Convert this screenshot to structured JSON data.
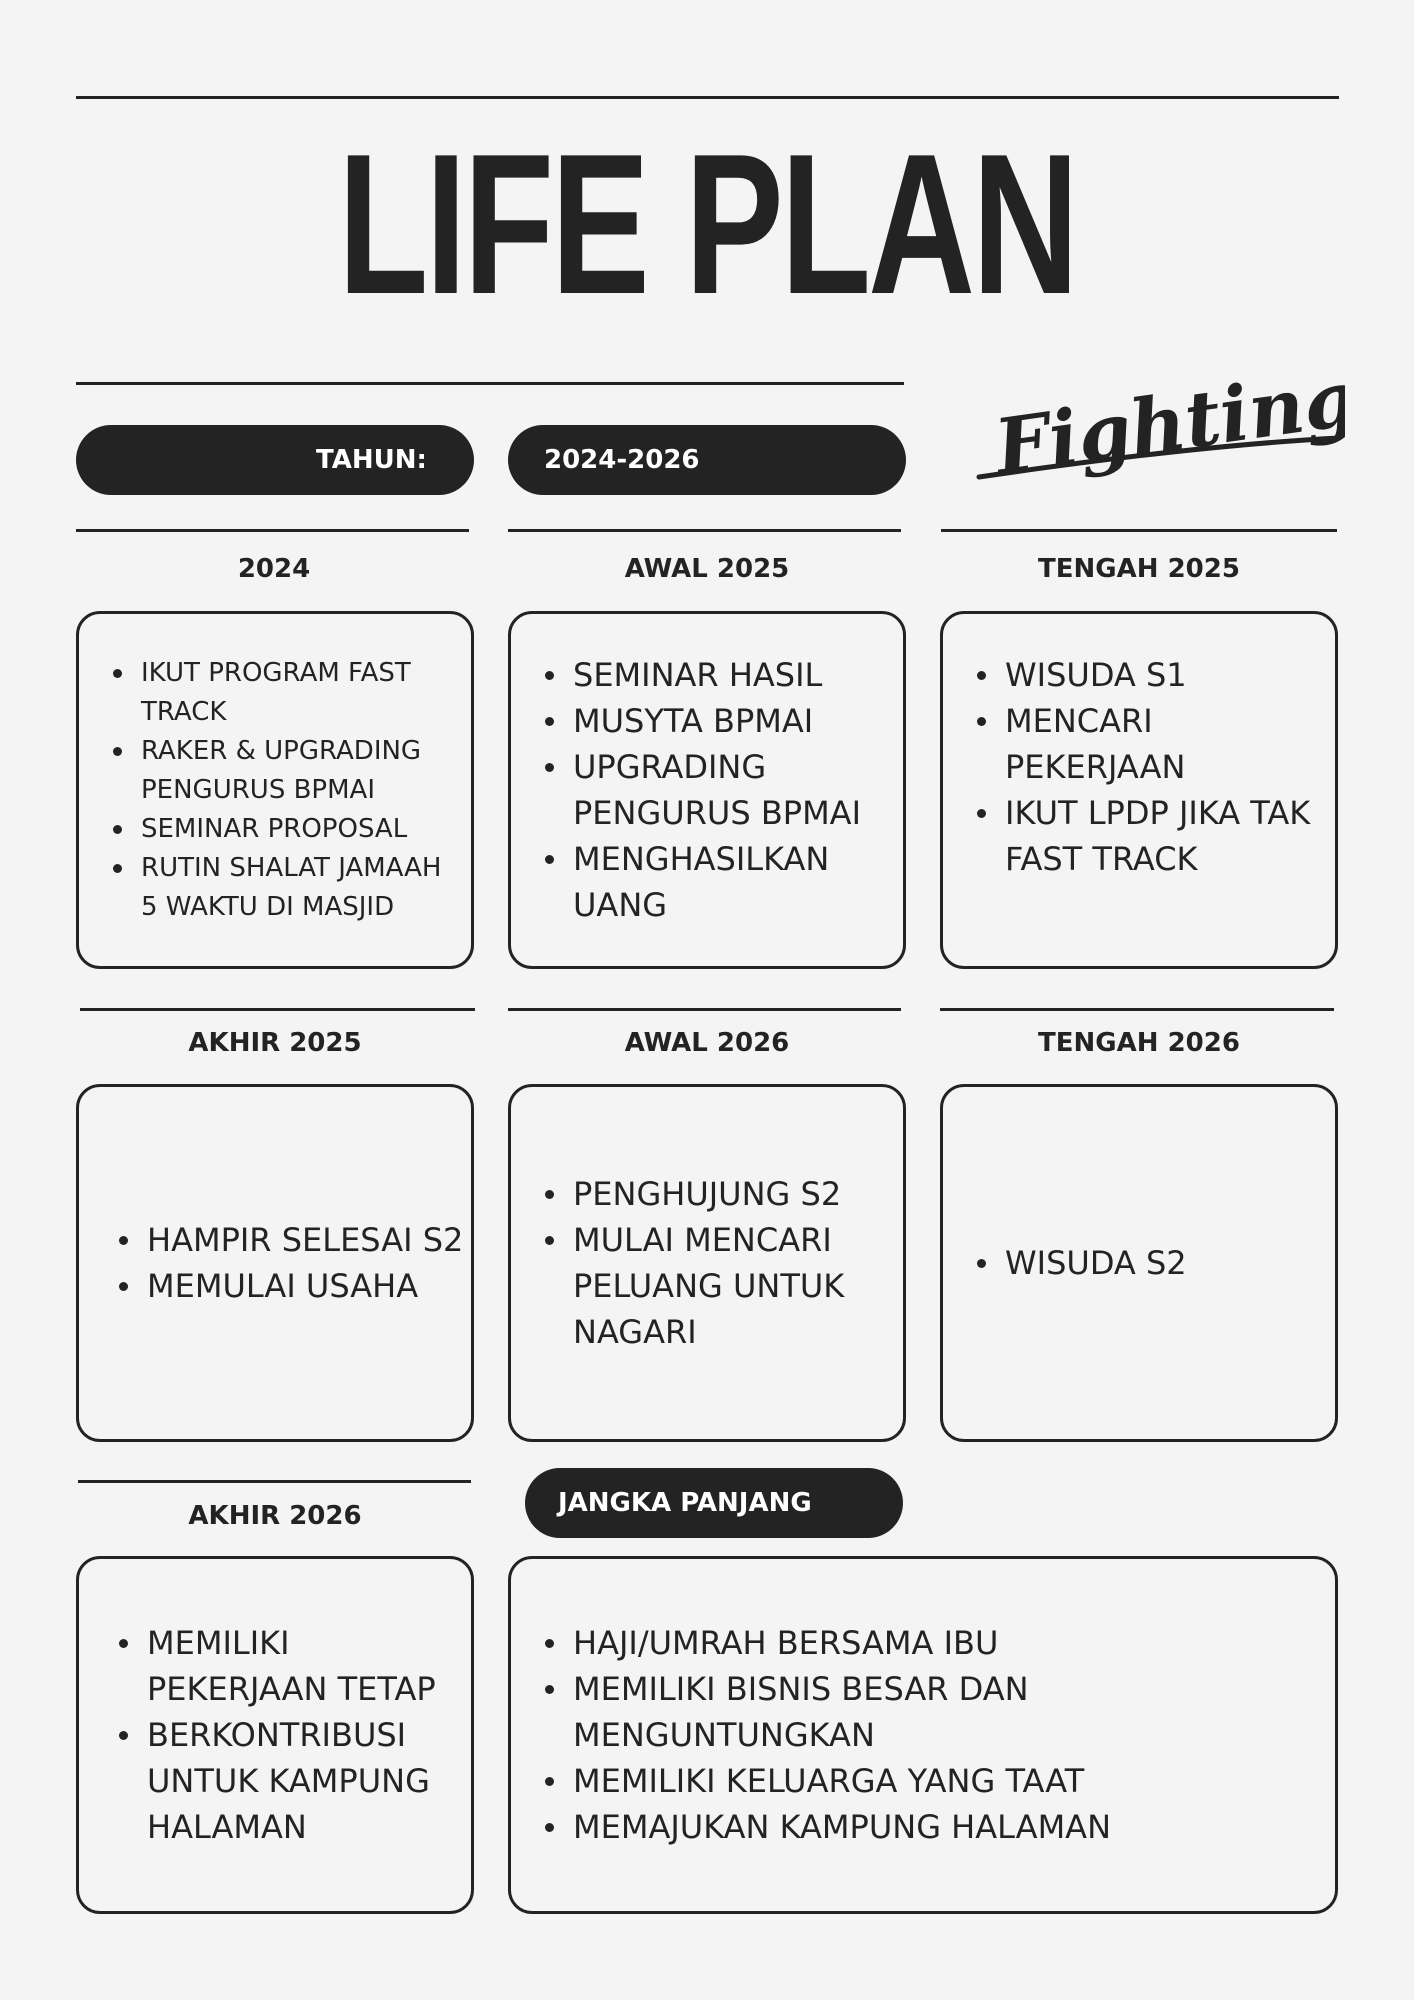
{
  "title": "LIFE PLAN",
  "tagline": "Fighting!",
  "year_label": "TAHUN:",
  "year_value": "2024-2026",
  "sections": {
    "s2024": {
      "label": "2024",
      "items": [
        "IKUT PROGRAM FAST TRACK",
        "RAKER & UPGRADING PENGURUS BPMAI",
        "SEMINAR PROPOSAL",
        "RUTIN SHALAT JAMAAH 5 WAKTU DI MASJID"
      ]
    },
    "awal2025": {
      "label": "AWAL 2025",
      "items": [
        "SEMINAR HASIL",
        "MUSYTA BPMAI",
        "UPGRADING PENGURUS BPMAI",
        "MENGHASILKAN UANG"
      ]
    },
    "tengah2025": {
      "label": "TENGAH 2025",
      "items": [
        "WISUDA S1",
        "MENCARI PEKERJAAN",
        "IKUT LPDP JIKA TAK FAST TRACK"
      ]
    },
    "akhir2025": {
      "label": "AKHIR 2025",
      "items": [
        "HAMPIR SELESAI S2",
        "MEMULAI USAHA"
      ]
    },
    "awal2026": {
      "label": "AWAL 2026",
      "items": [
        "PENGHUJUNG S2",
        "MULAI MENCARI PELUANG UNTUK NAGARI"
      ]
    },
    "tengah2026": {
      "label": "TENGAH 2026",
      "items": [
        "WISUDA S2"
      ]
    },
    "akhir2026": {
      "label": "AKHIR 2026",
      "items": [
        "MEMILIKI PEKERJAAN TETAP",
        "BERKONTRIBUSI UNTUK KAMPUNG HALAMAN"
      ]
    },
    "jangka": {
      "label": "JANGKA PANJANG",
      "items": [
        "HAJI/UMRAH BERSAMA IBU",
        "MEMILIKI BISNIS BESAR DAN MENGUNTUNGKAN",
        "MEMILIKI KELUARGA YANG TAAT",
        "MEMAJUKAN KAMPUNG HALAMAN"
      ]
    }
  }
}
